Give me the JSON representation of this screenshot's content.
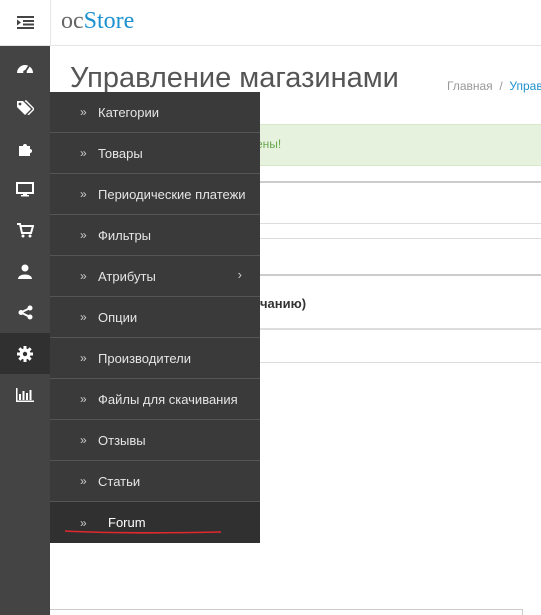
{
  "header": {
    "logo_oc": "oc",
    "logo_store": "Store"
  },
  "page": {
    "title": "Управление магазинами",
    "breadcrumb_home": "Главная",
    "breadcrumb_current": "Управ",
    "alert_text": "ены!",
    "panel_text": "чанию)"
  },
  "sidebar": {
    "icons": [
      "dashboard-icon",
      "tags-icon",
      "puzzle-icon",
      "desktop-icon",
      "cart-icon",
      "user-icon",
      "share-icon",
      "gear-icon",
      "bar-chart-icon"
    ],
    "active_index": 7
  },
  "submenu": {
    "items": [
      {
        "label": "Категории"
      },
      {
        "label": "Товары"
      },
      {
        "label": "Периодические платежи"
      },
      {
        "label": "Фильтры"
      },
      {
        "label": "Атрибуты"
      },
      {
        "label": "Опции"
      },
      {
        "label": "Производители"
      },
      {
        "label": "Файлы для скачивания"
      },
      {
        "label": "Отзывы"
      },
      {
        "label": "Статьи"
      },
      {
        "label": "Forum"
      }
    ],
    "arrow_glyph": "»",
    "submenu_caret": "›",
    "highlight_color": "#e0282d"
  }
}
